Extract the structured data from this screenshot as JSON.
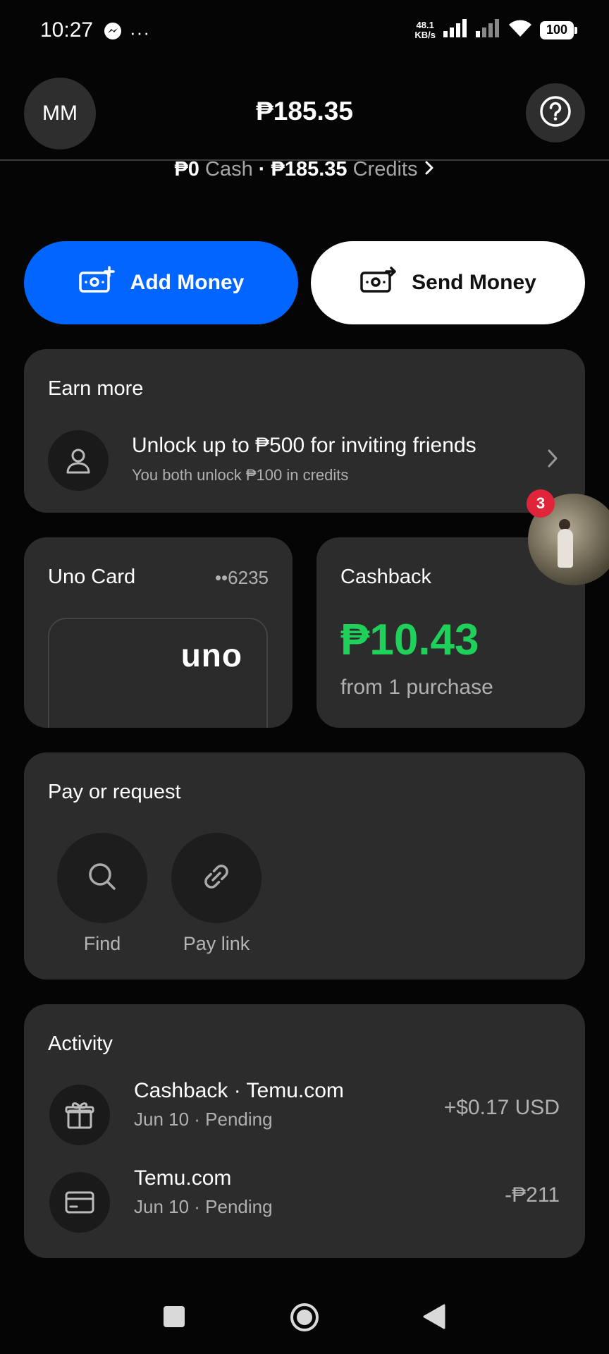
{
  "status_bar": {
    "time": "10:27",
    "messenger_icon": "messenger-icon",
    "more": "···",
    "net_speed_value": "48.1",
    "net_speed_unit": "KB/s",
    "battery": "100"
  },
  "header": {
    "avatar_initials": "MM",
    "balance": "₱185.35",
    "cash_amount": "₱0",
    "cash_label": "Cash",
    "credits_amount": "₱185.35",
    "credits_label": "Credits",
    "separator": "·"
  },
  "actions": {
    "add_money": "Add Money",
    "send_money": "Send Money"
  },
  "earn": {
    "title": "Earn more",
    "headline": "Unlock up to ₱500 for inviting friends",
    "sub": "You both unlock ₱100 in credits"
  },
  "chat_bubble": {
    "badge_count": "3"
  },
  "uno_card": {
    "title": "Uno Card",
    "last4": "••6235",
    "logo": "uno"
  },
  "cashback": {
    "title": "Cashback",
    "amount": "₱10.43",
    "from": "from 1 purchase"
  },
  "pay": {
    "title": "Pay or request",
    "find": "Find",
    "pay_link": "Pay link"
  },
  "activity": {
    "title": "Activity",
    "items": [
      {
        "name": "Cashback · Temu.com",
        "meta": "Jun 10 · Pending",
        "amount": "+$0.17 USD",
        "icon": "gift-icon"
      },
      {
        "name": "Temu.com",
        "meta": "Jun 10 · Pending",
        "amount": "-₱211",
        "icon": "card-icon"
      }
    ]
  },
  "colors": {
    "accent": "#0066ff",
    "cashback_green": "#1fd15a",
    "badge_red": "#e0243a",
    "card_bg": "#2c2c2c"
  }
}
